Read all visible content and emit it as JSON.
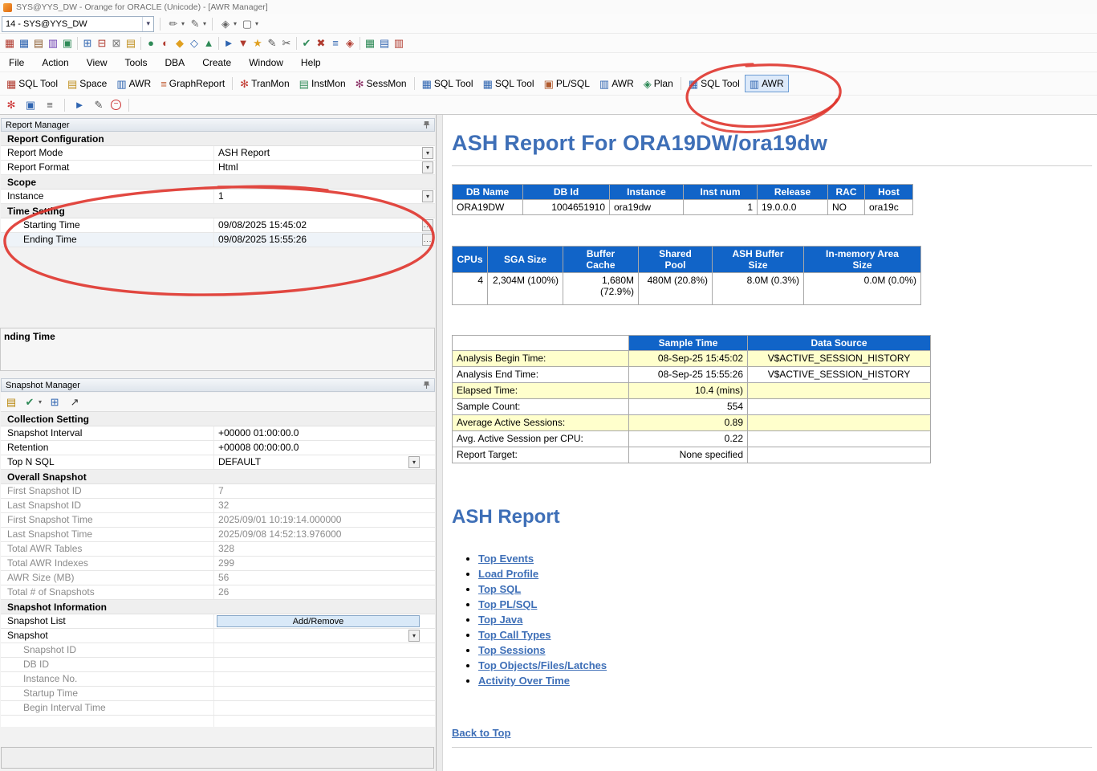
{
  "window": {
    "title": "SYS@YYS_DW - Orange for ORACLE (Unicode) - [AWR Manager]",
    "session_combo": "14 - SYS@YYS_DW"
  },
  "menubar": {
    "items": [
      "File",
      "Action",
      "View",
      "Tools",
      "DBA",
      "Create",
      "Window",
      "Help"
    ]
  },
  "apptoolbar": {
    "buttons": [
      {
        "label": "SQL Tool"
      },
      {
        "label": "Space"
      },
      {
        "label": "AWR"
      },
      {
        "label": "GraphReport"
      },
      {
        "label": "TranMon"
      },
      {
        "label": "InstMon"
      },
      {
        "label": "SessMon"
      },
      {
        "label": "SQL Tool"
      },
      {
        "label": "SQL Tool"
      },
      {
        "label": "PL/SQL"
      },
      {
        "label": "AWR"
      },
      {
        "label": "Plan"
      },
      {
        "label": "SQL Tool"
      },
      {
        "label": "AWR"
      }
    ]
  },
  "report_manager": {
    "title": "Report Manager",
    "section_configuration": "Report Configuration",
    "report_mode_label": "Report Mode",
    "report_mode_value": "ASH Report",
    "report_format_label": "Report Format",
    "report_format_value": "Html",
    "section_scope": "Scope",
    "instance_label": "Instance",
    "instance_value": "1",
    "section_time": "Time Setting",
    "starting_time_label": "Starting Time",
    "starting_time_value": "09/08/2025 15:45:02",
    "ending_time_label": "Ending Time",
    "ending_time_value": "09/08/2025 15:55:26",
    "floating_partial_label": "nding Time"
  },
  "snapshot_manager": {
    "title": "Snapshot Manager",
    "section_collection": "Collection Setting",
    "rows_collection": [
      {
        "label": "Snapshot Interval",
        "value": "+00000 01:00:00.0"
      },
      {
        "label": "Retention",
        "value": "+00008 00:00:00.0"
      },
      {
        "label": "Top N SQL",
        "value": "DEFAULT"
      }
    ],
    "section_overall": "Overall Snapshot",
    "rows_overall": [
      {
        "label": "First Snapshot ID",
        "value": "7"
      },
      {
        "label": "Last Snapshot ID",
        "value": "32"
      },
      {
        "label": "First Snapshot Time",
        "value": "2025/09/01 10:19:14.000000"
      },
      {
        "label": "Last Snapshot Time",
        "value": "2025/09/08 14:52:13.976000"
      },
      {
        "label": "Total AWR Tables",
        "value": "328"
      },
      {
        "label": "Total AWR Indexes",
        "value": "299"
      },
      {
        "label": "AWR Size (MB)",
        "value": "56"
      },
      {
        "label": "Total # of Snapshots",
        "value": "26"
      }
    ],
    "section_info": "Snapshot Information",
    "snapshot_list_label": "Snapshot List",
    "add_remove_button": "Add/Remove",
    "snapshot_label": "Snapshot",
    "info_rows": [
      "Snapshot ID",
      "DB ID",
      "Instance No.",
      "Startup Time",
      "Begin Interval Time"
    ]
  },
  "report": {
    "title": "ASH Report For ORA19DW/ora19dw",
    "db_table": {
      "headers": [
        "DB Name",
        "DB Id",
        "Instance",
        "Inst num",
        "Release",
        "RAC",
        "Host"
      ],
      "row": [
        "ORA19DW",
        "1004651910",
        "ora19dw",
        "1",
        "19.0.0.0",
        "NO",
        "ora19c"
      ]
    },
    "sga_table": {
      "headers": [
        "CPUs",
        "SGA Size",
        "Buffer Cache",
        "Shared Pool",
        "ASH Buffer Size",
        "In-memory Area Size"
      ],
      "row": [
        "4",
        "2,304M (100%)",
        "1,680M (72.9%)",
        "480M (20.8%)",
        "8.0M (0.3%)",
        "0.0M (0.0%)"
      ]
    },
    "sample_table": {
      "headers": [
        "",
        "Sample Time",
        "Data Source"
      ],
      "rows": [
        [
          "Analysis Begin Time:",
          "08-Sep-25 15:45:02",
          "V$ACTIVE_SESSION_HISTORY"
        ],
        [
          "Analysis End Time:",
          "08-Sep-25 15:55:26",
          "V$ACTIVE_SESSION_HISTORY"
        ],
        [
          "Elapsed Time:",
          "10.4 (mins)",
          ""
        ],
        [
          "Sample Count:",
          "554",
          ""
        ],
        [
          "Average Active Sessions:",
          "0.89",
          ""
        ],
        [
          "Avg. Active Session per CPU:",
          "0.22",
          ""
        ],
        [
          "Report Target:",
          "None specified",
          ""
        ]
      ]
    },
    "section_heading": "ASH Report",
    "links": [
      "Top Events",
      "Load Profile",
      "Top SQL",
      "Top PL/SQL",
      "Top Java",
      "Top Call Types",
      "Top Sessions",
      "Top Objects/Files/Latches",
      "Activity Over Time"
    ],
    "back_link": "Back to Top"
  },
  "icons": {
    "chevron-down": "▾",
    "more": "...",
    "grid": "▦",
    "rows": "▤",
    "cols": "▥",
    "cell": "▣",
    "box": "▢",
    "plus": "⊞",
    "minus-sq": "⊟",
    "times-sq": "⊠",
    "circle": "●",
    "half": "◐",
    "diamond": "◆",
    "odiamond": "◇",
    "tri": "▲",
    "play": "►",
    "down": "▼",
    "star": "★",
    "pencil": "✎",
    "pen": "✏",
    "scissors": "✂",
    "check": "✔",
    "cross": "✖",
    "bars": "≡",
    "gem": "◈",
    "asterisk": "✻",
    "minus": "−",
    "arrow-ne": "↗",
    "db": "▤",
    "disk": "▣"
  },
  "colors": {
    "header_blue": "#1164c8",
    "title_blue": "#3e6fb7",
    "row_yellow": "#ffffcc",
    "annotation_red": "#df342c"
  }
}
